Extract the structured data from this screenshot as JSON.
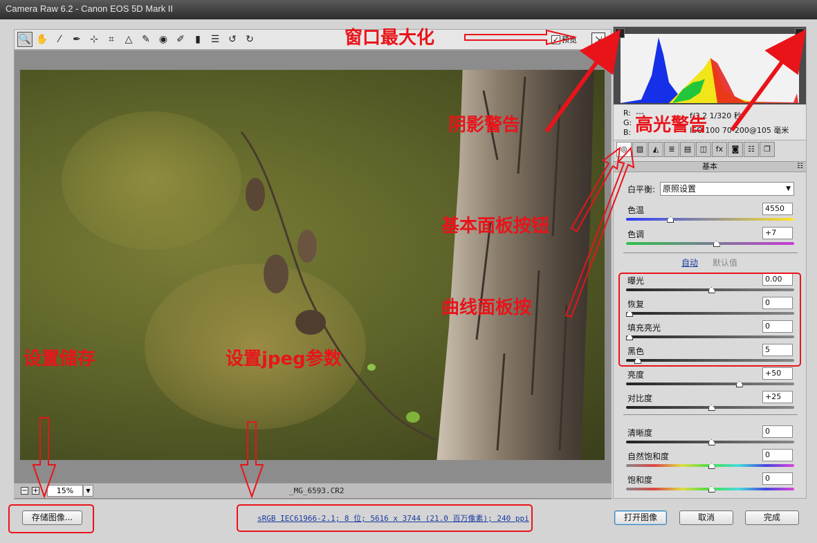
{
  "window": {
    "title": "Camera Raw 6.2 -  Canon EOS 5D Mark II"
  },
  "toolbar": {
    "tools": [
      {
        "icon": "zoom-icon",
        "glyph": "🔍"
      },
      {
        "icon": "hand-icon",
        "glyph": "✋"
      },
      {
        "icon": "white-balance-icon",
        "glyph": "⁄"
      },
      {
        "icon": "color-sampler-icon",
        "glyph": "✒"
      },
      {
        "icon": "target-adjust-icon",
        "glyph": "⊹"
      },
      {
        "icon": "crop-icon",
        "glyph": "⌗"
      },
      {
        "icon": "straighten-icon",
        "glyph": "△"
      },
      {
        "icon": "spot-removal-icon",
        "glyph": "✎"
      },
      {
        "icon": "red-eye-icon",
        "glyph": "◉"
      },
      {
        "icon": "adjustment-brush-icon",
        "glyph": "✐"
      },
      {
        "icon": "graduated-filter-icon",
        "glyph": "▮"
      },
      {
        "icon": "preferences-icon",
        "glyph": "☰"
      },
      {
        "icon": "rotate-ccw-icon",
        "glyph": "↺"
      },
      {
        "icon": "rotate-cw-icon",
        "glyph": "↻"
      }
    ],
    "preview_label": "预览",
    "preview_checked": "✓"
  },
  "status": {
    "zoom_minus": "−",
    "zoom_plus": "+",
    "zoom": "15%",
    "filename": "_MG_6593.CR2"
  },
  "histogram": {
    "r": "R:",
    "g": "G:",
    "b": "B:",
    "r_val": "---",
    "exif1": "f/3.2   1/320 秒",
    "exif2": "ISO 100   70-200@105 毫米"
  },
  "panel": {
    "tabs": [
      "◎",
      "▨",
      "◭",
      "≣",
      "▤",
      "◫",
      "fx",
      "◙",
      "☷",
      "❐"
    ],
    "title": "基本",
    "menu": "☷",
    "white_balance_label": "白平衡:",
    "white_balance_value": "原照设置",
    "auto": "自动",
    "default": "默认值",
    "sliders": [
      {
        "label": "色温",
        "value": "4550",
        "pos": 0.25,
        "track": "temp"
      },
      {
        "label": "色调",
        "value": "+7",
        "pos": 0.53,
        "track": "tint"
      },
      {
        "label": "曝光",
        "value": "0.00",
        "pos": 0.5,
        "track": "gray"
      },
      {
        "label": "恢复",
        "value": "0",
        "pos": 0.0,
        "track": "gray"
      },
      {
        "label": "填充亮光",
        "value": "0",
        "pos": 0.0,
        "track": "gray"
      },
      {
        "label": "黑色",
        "value": "5",
        "pos": 0.05,
        "track": "gray"
      },
      {
        "label": "亮度",
        "value": "+50",
        "pos": 0.67,
        "track": "gray"
      },
      {
        "label": "对比度",
        "value": "+25",
        "pos": 0.5,
        "track": "gray"
      },
      {
        "label": "清晰度",
        "value": "0",
        "pos": 0.5,
        "track": "gray"
      },
      {
        "label": "自然饱和度",
        "value": "0",
        "pos": 0.5,
        "track": "sat"
      },
      {
        "label": "饱和度",
        "value": "0",
        "pos": 0.5,
        "track": "sat"
      }
    ]
  },
  "bottom": {
    "save": "存储图像...",
    "workflow": "sRGB IEC61966-2.1; 8 位; 5616 x 3744 (21.0 百万像素); 240 ppi",
    "open": "打开图像",
    "cancel": "取消",
    "done": "完成"
  },
  "annotations": {
    "maximize": "窗口最大化",
    "shadow": "阴影警告",
    "highlight": "高光警告",
    "basic": "基本面板按钮",
    "curve": "曲线面板按",
    "save_settings": "设置储存",
    "jpeg": "设置jpeg参数"
  },
  "colors": {
    "annotation": "#e8141a",
    "workflow_link": "#1a3a9e"
  }
}
